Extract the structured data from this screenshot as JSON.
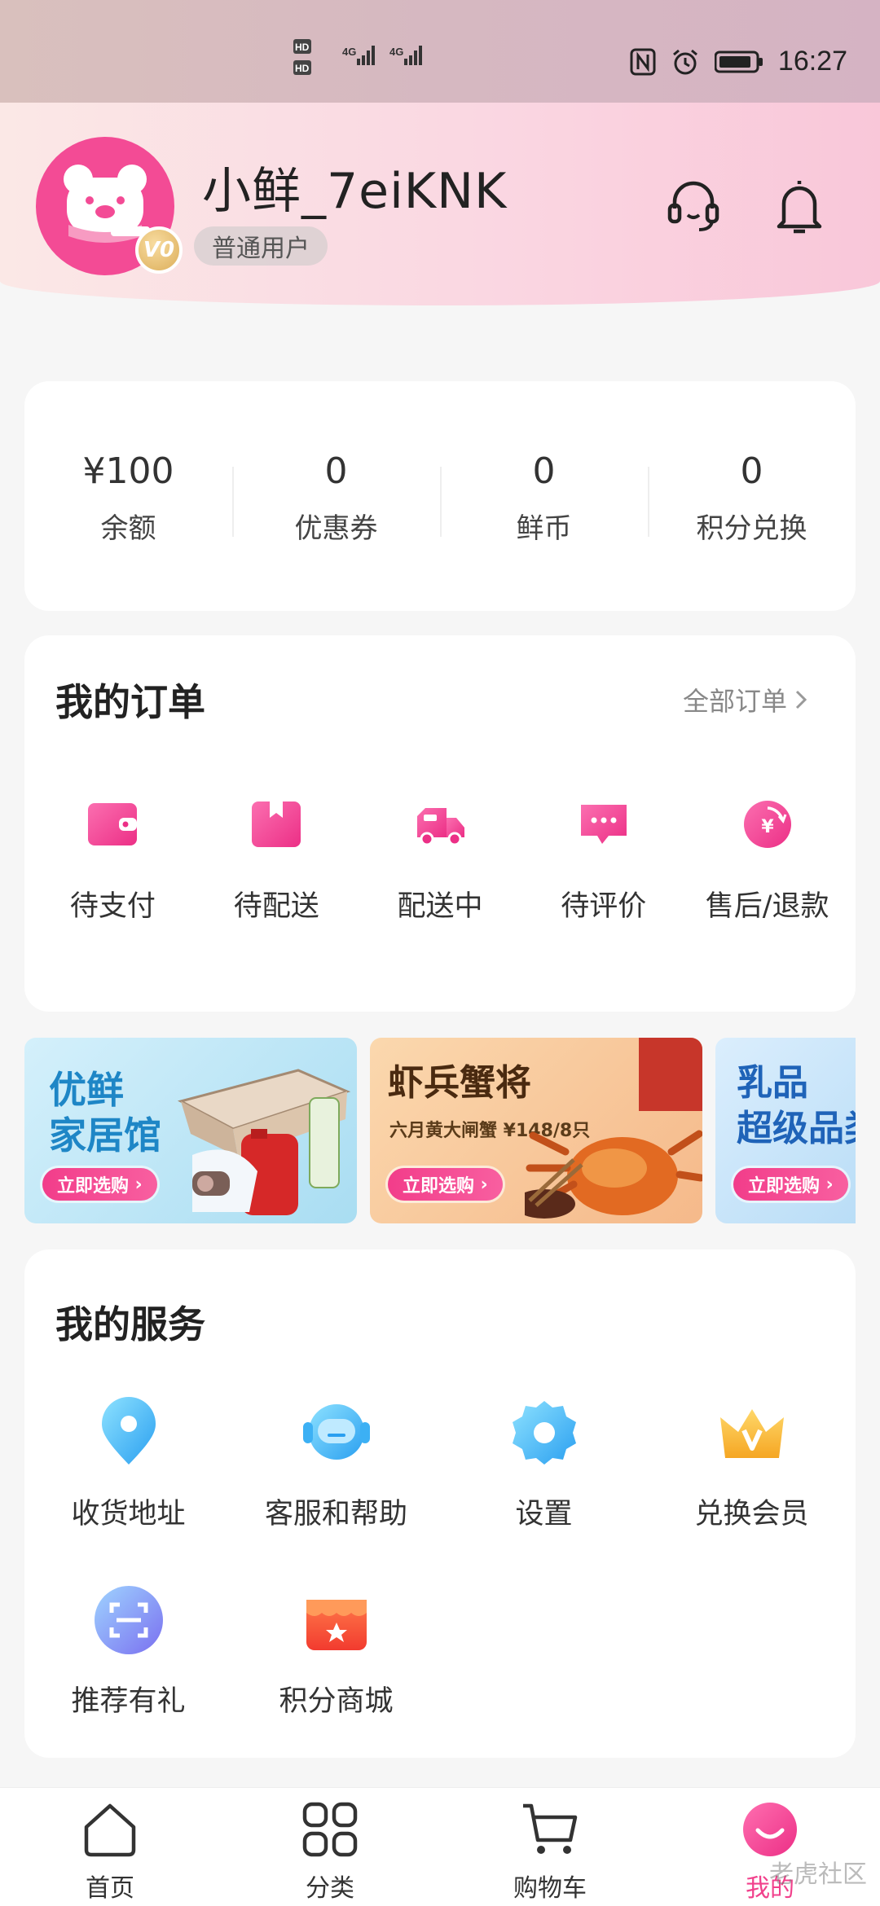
{
  "status_bar": {
    "time": "16:27",
    "sim1": "HD",
    "sim2": "HD",
    "network1": "4G",
    "network2": "4G"
  },
  "profile": {
    "username": "小鲜_7eiKNK",
    "level": "普通用户",
    "vip_badge": "V0",
    "icons": [
      "customer-service-icon",
      "bell-icon"
    ]
  },
  "stats": [
    {
      "value": "¥100",
      "label": "余额"
    },
    {
      "value": "0",
      "label": "优惠券"
    },
    {
      "value": "0",
      "label": "鲜币"
    },
    {
      "value": "0",
      "label": "积分兑换"
    }
  ],
  "orders": {
    "title": "我的订单",
    "all_orders": "全部订单",
    "items": [
      {
        "label": "待支付",
        "icon": "wallet-icon"
      },
      {
        "label": "待配送",
        "icon": "package-icon"
      },
      {
        "label": "配送中",
        "icon": "delivery-truck-icon"
      },
      {
        "label": "待评价",
        "icon": "comment-icon"
      },
      {
        "label": "售后/退款",
        "icon": "refund-icon"
      }
    ]
  },
  "banners": [
    {
      "title_line1": "优鲜",
      "title_line2": "家居馆",
      "subtitle": "",
      "button": "立即选购"
    },
    {
      "title_line1": "虾兵蟹将",
      "title_line2": "",
      "subtitle": "六月黄大闸蟹 ¥148/8只",
      "button": "立即选购"
    },
    {
      "title_line1": "乳品",
      "title_line2": "超级品类",
      "subtitle": "",
      "button": "立即选购"
    }
  ],
  "services": {
    "title": "我的服务",
    "items": [
      {
        "label": "收货地址",
        "icon": "location-pin-icon"
      },
      {
        "label": "客服和帮助",
        "icon": "headset-icon"
      },
      {
        "label": "设置",
        "icon": "gear-icon"
      },
      {
        "label": "兑换会员",
        "icon": "crown-icon"
      },
      {
        "label": "推荐有礼",
        "icon": "scan-icon"
      },
      {
        "label": "积分商城",
        "icon": "store-icon"
      }
    ]
  },
  "bottom_nav": [
    {
      "label": "首页",
      "icon": "home-icon"
    },
    {
      "label": "分类",
      "icon": "category-icon"
    },
    {
      "label": "购物车",
      "icon": "cart-icon"
    },
    {
      "label": "我的",
      "icon": "profile-icon",
      "active": true
    }
  ],
  "watermark": "老虎社区",
  "colors": {
    "accent": "#f1418c",
    "avatar_bg": "#f34b95",
    "header_gradient": [
      "#fbe8e6",
      "#f9c7d9"
    ]
  }
}
